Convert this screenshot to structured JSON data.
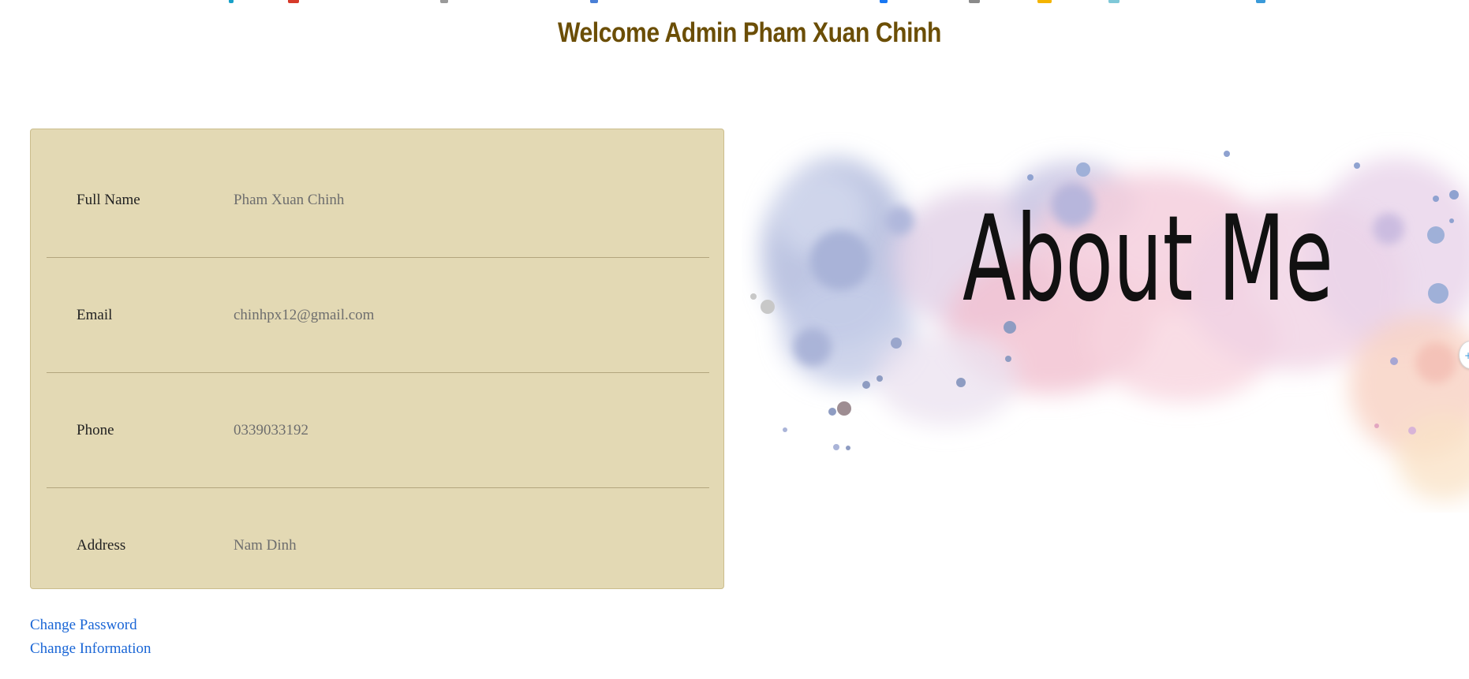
{
  "page": {
    "title": "Welcome Admin Pham Xuan Chinh"
  },
  "profile": {
    "rows": [
      {
        "label": "Full Name",
        "value": "Pham Xuan Chinh"
      },
      {
        "label": "Email",
        "value": "chinhpx12@gmail.com"
      },
      {
        "label": "Phone",
        "value": "0339033192"
      },
      {
        "label": "Address",
        "value": "Nam Dinh"
      }
    ]
  },
  "links": {
    "change_password": "Change Password",
    "change_information": "Change Information"
  },
  "banner": {
    "text": "About Me"
  },
  "edge_handle": {
    "icon": "plus-icon"
  },
  "colors": {
    "title": "#6b4e06",
    "card_background": "#e3d9b4",
    "link": "#1a66d6"
  }
}
